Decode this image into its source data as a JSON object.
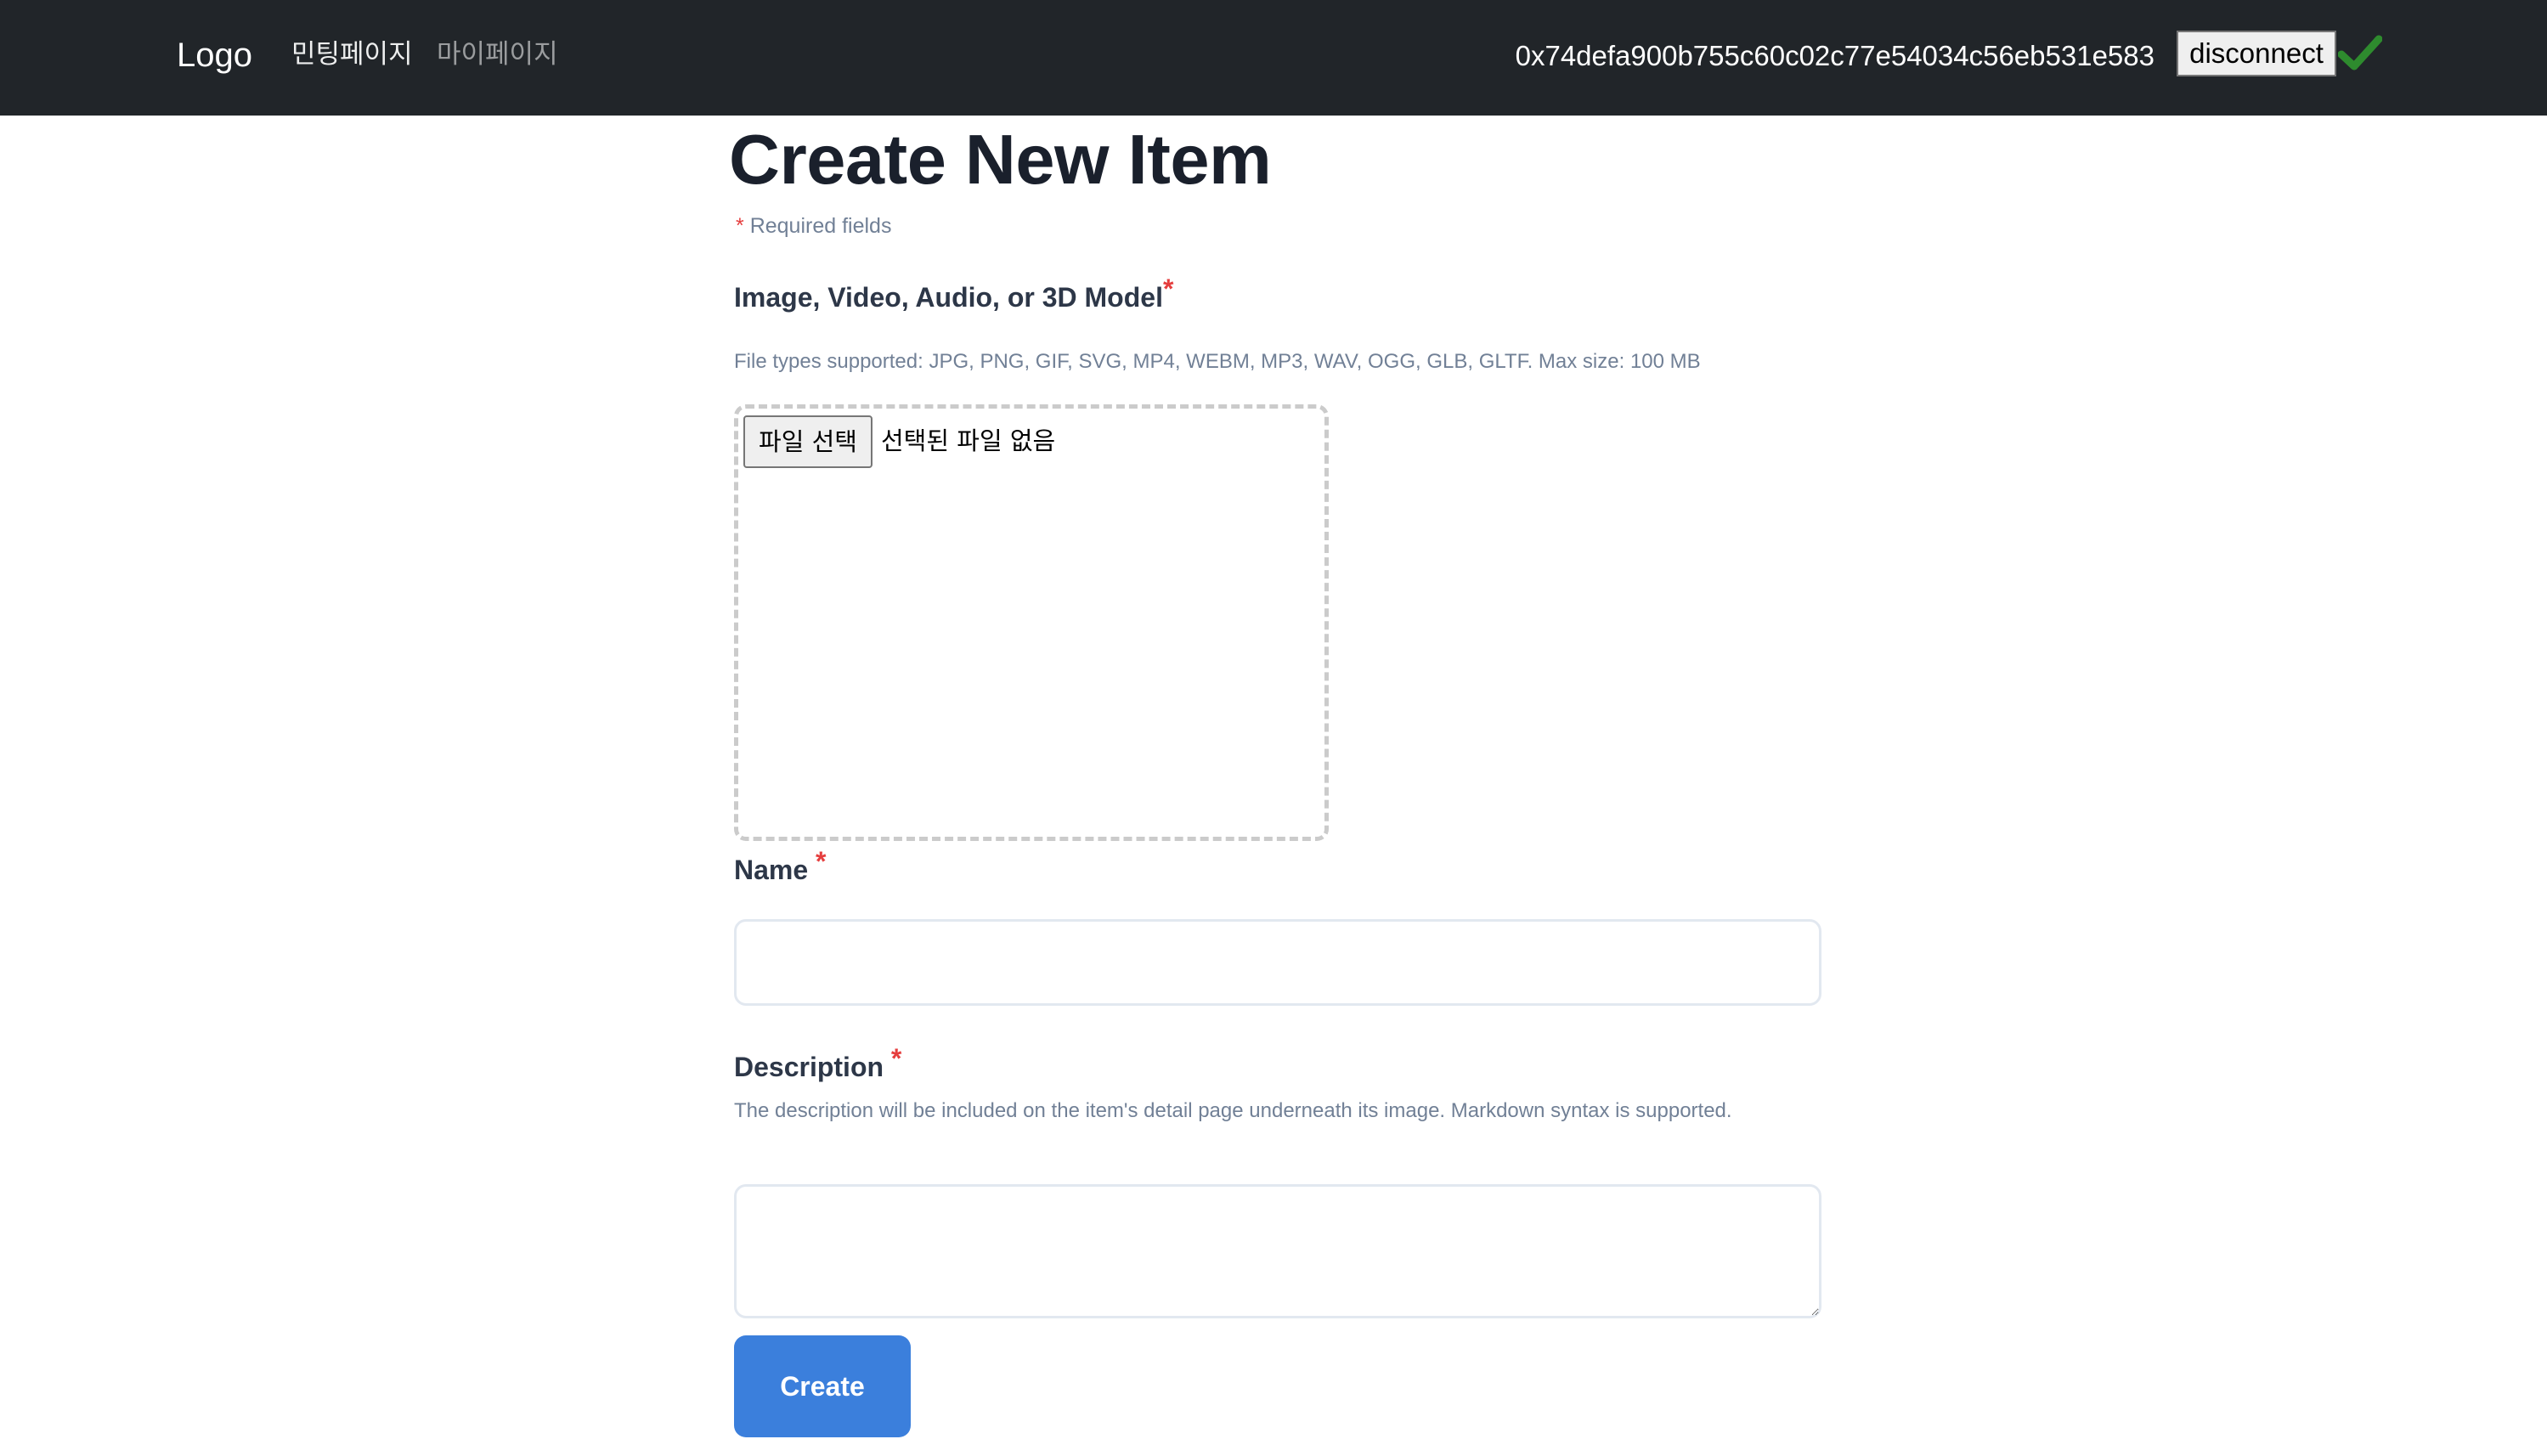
{
  "navbar": {
    "brand": "Logo",
    "links": [
      {
        "label": "민팅페이지"
      },
      {
        "label": "마이페이지"
      }
    ],
    "wallet_address": "0x74defa900b755c60c02c77e54034c56eb531e583",
    "disconnect_label": "disconnect",
    "status_icon": "check-icon",
    "status_color": "#2e8b2e"
  },
  "form": {
    "title": "Create New Item",
    "required_note": {
      "asterisk": "*",
      "text": "Required fields"
    },
    "media": {
      "label": "Image, Video, Audio, or 3D Model",
      "asterisk": "*",
      "hint": "File types supported: JPG, PNG, GIF, SVG, MP4, WEBM, MP3, WAV, OGG, GLB, GLTF. Max size: 100 MB",
      "file_button_label": "파일 선택",
      "file_status": "선택된 파일 없음"
    },
    "name": {
      "label": "Name",
      "asterisk": "*",
      "value": "",
      "placeholder": ""
    },
    "description": {
      "label": "Description",
      "asterisk": "*",
      "hint": "The description will be included on the item's detail page underneath its image. Markdown syntax is supported.",
      "value": "",
      "placeholder": ""
    },
    "submit_label": "Create",
    "accent_color": "#3b7fdc",
    "required_color": "#e53e3e"
  }
}
